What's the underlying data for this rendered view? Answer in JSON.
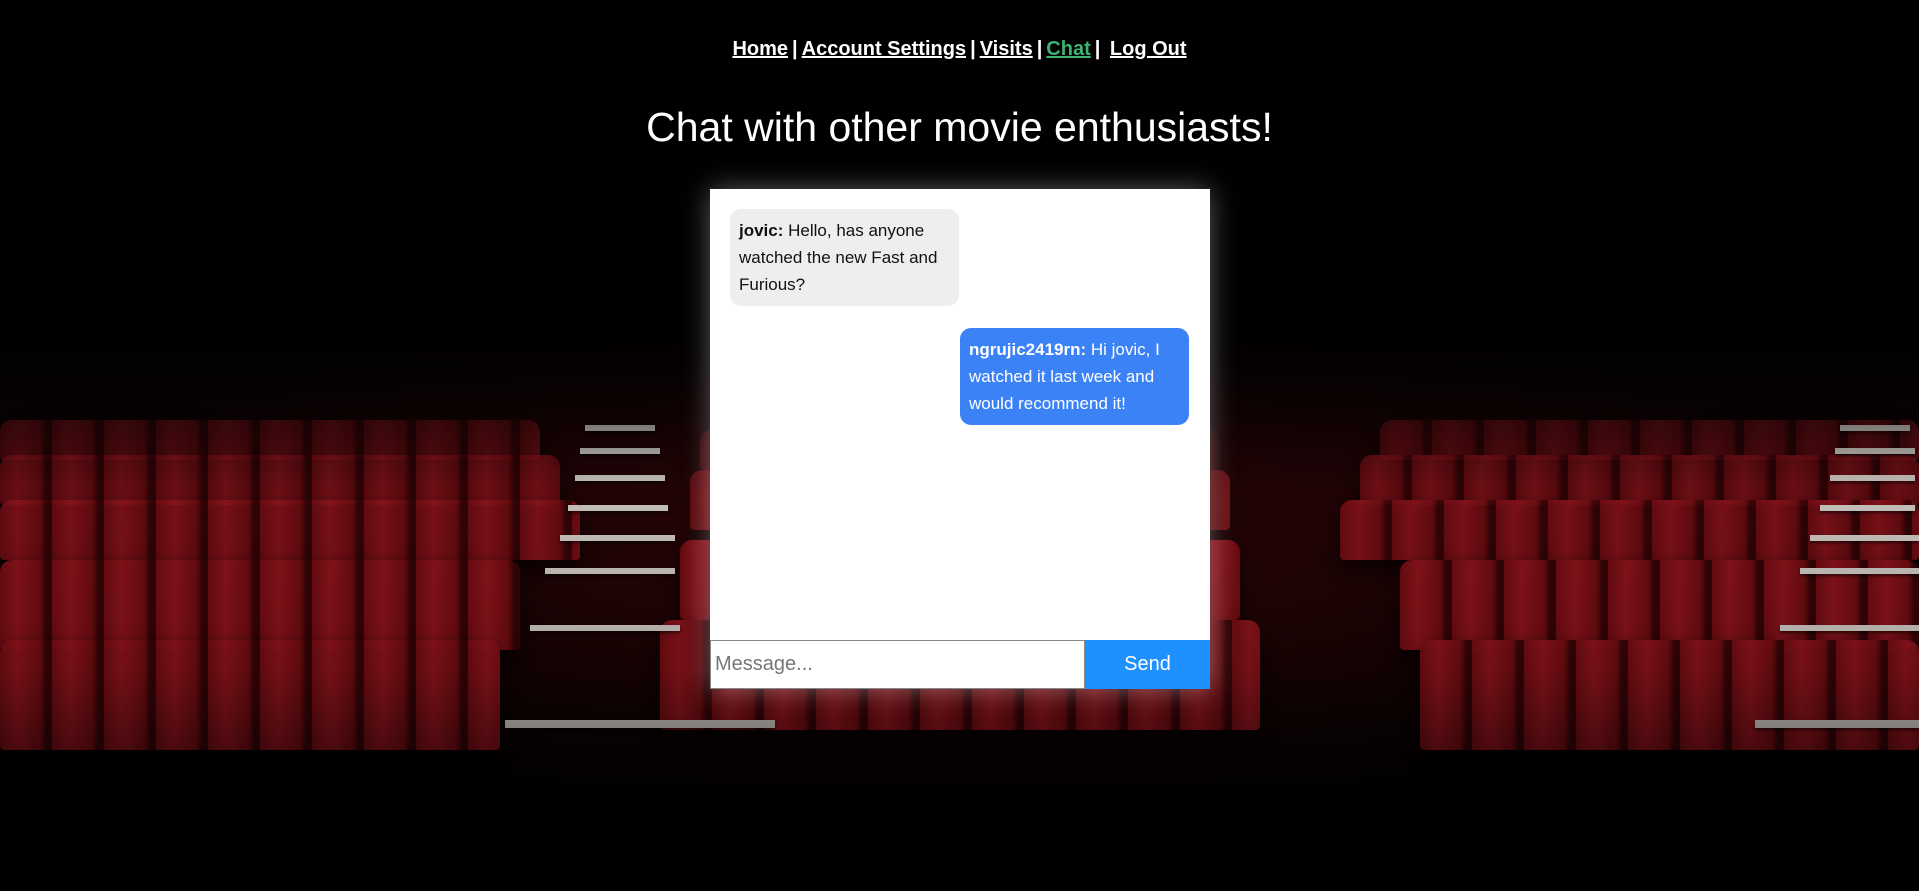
{
  "nav": {
    "items": [
      {
        "label": "Home"
      },
      {
        "label": "Account Settings"
      },
      {
        "label": "Visits"
      },
      {
        "label": "Chat",
        "active": true
      },
      {
        "label": "Log Out"
      }
    ],
    "separator": "|",
    "active_color": "#3cb371"
  },
  "page": {
    "heading": "Chat with other movie enthusiasts!"
  },
  "chat": {
    "messages": [
      {
        "author": "jovic:",
        "text": " Hello, has anyone watched the new Fast and Furious?",
        "side": "left"
      },
      {
        "author": "ngrujic2419rn:",
        "text": " Hi jovic, I watched it last week and would recommend it!",
        "side": "right"
      }
    ],
    "input": {
      "placeholder": "Message...",
      "value": ""
    },
    "send_label": "Send",
    "own_bubble_color": "#3b82f6",
    "send_button_color": "#1e90ff"
  }
}
